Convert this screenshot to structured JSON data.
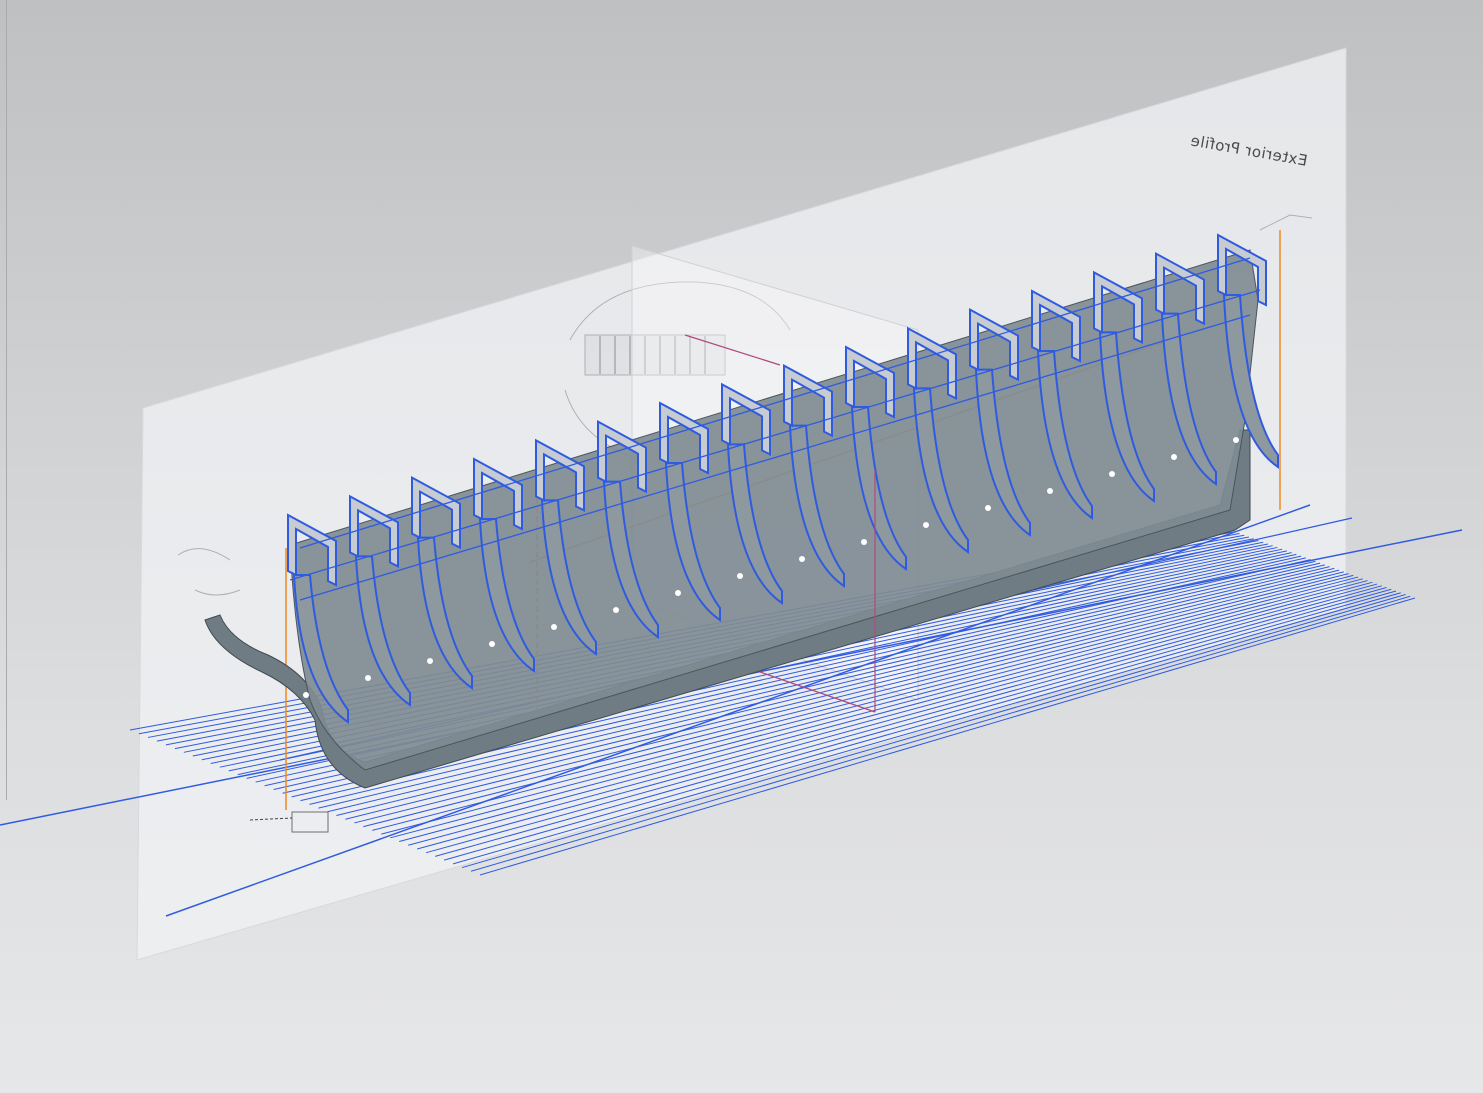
{
  "viewport": {
    "background_top": "#bfc0c2",
    "background_bottom": "#e6e7e9"
  },
  "drawing_sheet": {
    "title": "Exterior Profile",
    "title_mirrored": true
  },
  "colors": {
    "hull": "#79868e",
    "hull_dark": "#5e6a72",
    "frame_edge": "#2f5be0",
    "plan_lines": "#2f5be0",
    "guide_orange": "#ee8a22",
    "reference_magenta": "#b04a7c",
    "sheet": "#eeeff1"
  },
  "model": {
    "frame_count": 16,
    "waterline_count": 40
  }
}
